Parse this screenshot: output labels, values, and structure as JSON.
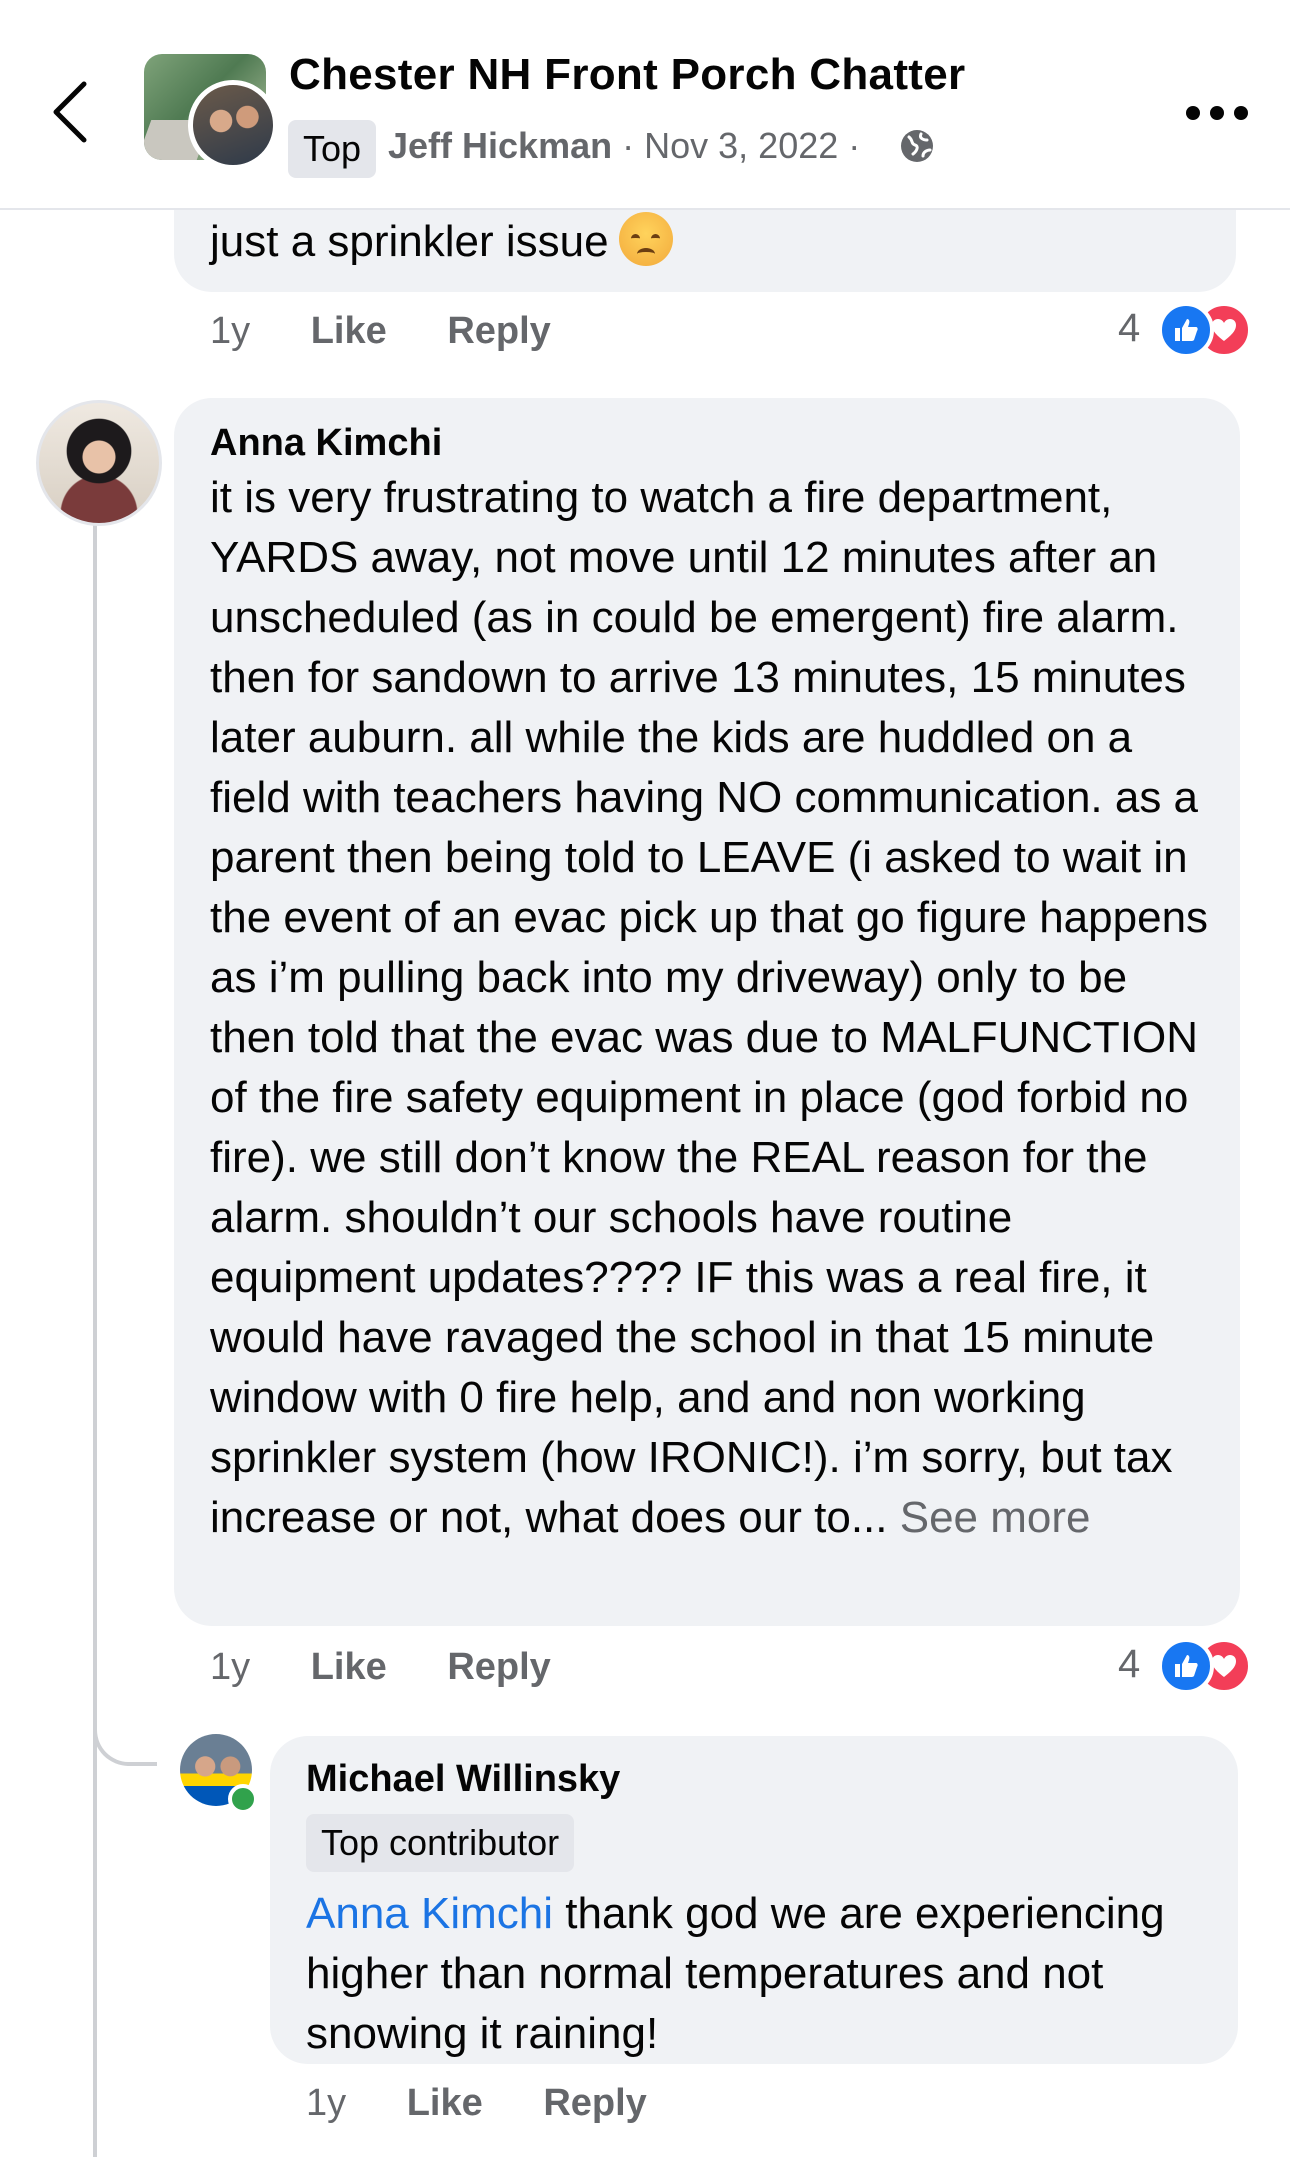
{
  "header": {
    "group_name": "Chester NH Front Porch Chatter",
    "badge": "Top",
    "author": "Jeff Hickman",
    "separator": "·",
    "date": "Nov 3, 2022",
    "privacy_icon": "globe-icon",
    "back_icon": "chevron-left-icon",
    "more_icon": "more-horizontal-icon"
  },
  "comments": [
    {
      "text": "just a sprinkler issue",
      "emoji": "disappointed-face",
      "time": "1y",
      "like_label": "Like",
      "reply_label": "Reply",
      "reaction_count": "4"
    },
    {
      "name": "Anna Kimchi",
      "text": "it is very frustrating to watch a fire department, YARDS away, not move until 12 minutes after an unscheduled (as in could be emergent) fire alarm. then for sandown to arrive 13 minutes, 15 minutes later auburn. all while the kids are huddled on a field with teachers having NO communication. as a parent then being told to LEAVE (i asked to wait in the event of an evac pick up that go figure happens as i’m pulling back into my driveway) only to be then told that the evac was due to MALFUNCTION of the fire safety equipment in place (god forbid no fire). we still don’t know the REAL reason for the alarm. shouldn’t our schools have routine equipment updates???? IF this was a real fire, it would have ravaged the school in that 15 minute window with 0 fire help, and and non working sprinkler system (how IRONIC!). i’m sorry, but tax increase or not, what does our to...",
      "see_more": "See more",
      "time": "1y",
      "like_label": "Like",
      "reply_label": "Reply",
      "reaction_count": "4"
    },
    {
      "name": "Michael Willinsky",
      "badge": "Top contributor",
      "mention": "Anna Kimchi",
      "text": "thank god we are experiencing higher than normal temperatures and not snowing it raining!",
      "time": "1y",
      "like_label": "Like",
      "reply_label": "Reply"
    }
  ],
  "colors": {
    "bubble": "#f0f2f5",
    "secondary_text": "#65676b",
    "like_blue": "#1877f2",
    "love_red": "#f33e58",
    "mention_blue": "#1b74e4",
    "online_green": "#31a24c"
  }
}
